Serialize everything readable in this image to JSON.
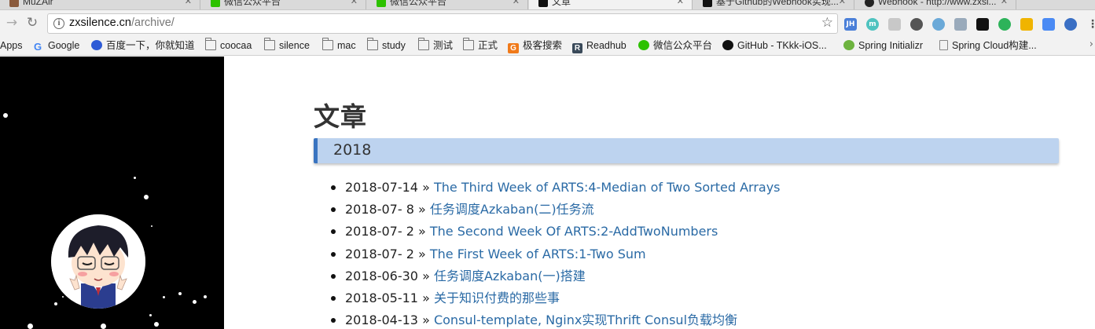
{
  "tabs": [
    {
      "label": "MuZAir",
      "active": false
    },
    {
      "label": "微信公众平台",
      "active": false
    },
    {
      "label": "微信公众平台",
      "active": false
    },
    {
      "label": "文章",
      "active": true
    },
    {
      "label": "基于Github的Webhook实现...",
      "active": false
    },
    {
      "label": "Webhook - http://www.zxsi...",
      "active": false
    }
  ],
  "address": {
    "host": "zxsilence.cn",
    "path": "/archive/"
  },
  "extensions": [
    "JH",
    "m",
    "",
    "",
    "",
    "",
    "",
    "",
    "",
    "",
    "",
    ""
  ],
  "bookmarks": [
    {
      "label": "Apps",
      "icon": "apps-icon"
    },
    {
      "label": "Google",
      "icon": "google-icon"
    },
    {
      "label": "百度一下，你就知道",
      "icon": "baidu-icon"
    },
    {
      "label": "coocaa",
      "icon": "folder-icon"
    },
    {
      "label": "silence",
      "icon": "folder-icon"
    },
    {
      "label": "mac",
      "icon": "folder-icon"
    },
    {
      "label": "study",
      "icon": "folder-icon"
    },
    {
      "label": "测试",
      "icon": "folder-icon"
    },
    {
      "label": "正式",
      "icon": "folder-icon"
    },
    {
      "label": "极客搜索",
      "icon": "geek-search-icon"
    },
    {
      "label": "Readhub",
      "icon": "readhub-icon"
    },
    {
      "label": "微信公众平台",
      "icon": "wechat-icon"
    },
    {
      "label": "GitHub - TKkk-iOS...",
      "icon": "github-icon"
    },
    {
      "label": "Spring Initializr",
      "icon": "spring-icon"
    },
    {
      "label": "Spring Cloud构建...",
      "icon": "page-icon"
    }
  ],
  "page": {
    "title": "文章",
    "year": "2018",
    "separator": "»",
    "posts": [
      {
        "date": "2018-07-14",
        "title": "The Third Week of ARTS:4-Median of Two Sorted Arrays"
      },
      {
        "date": "2018-07- 8",
        "title": "任务调度Azkaban(二)任务流"
      },
      {
        "date": "2018-07- 2",
        "title": "The Second Week Of ARTS:2-AddTwoNumbers"
      },
      {
        "date": "2018-07- 2",
        "title": "The First Week of ARTS:1-Two Sum"
      },
      {
        "date": "2018-06-30",
        "title": "任务调度Azkaban(一)搭建"
      },
      {
        "date": "2018-05-11",
        "title": "关于知识付费的那些事"
      },
      {
        "date": "2018-04-13",
        "title": "Consul-template, Nginx实现Thrift Consul负载均衡"
      }
    ]
  }
}
